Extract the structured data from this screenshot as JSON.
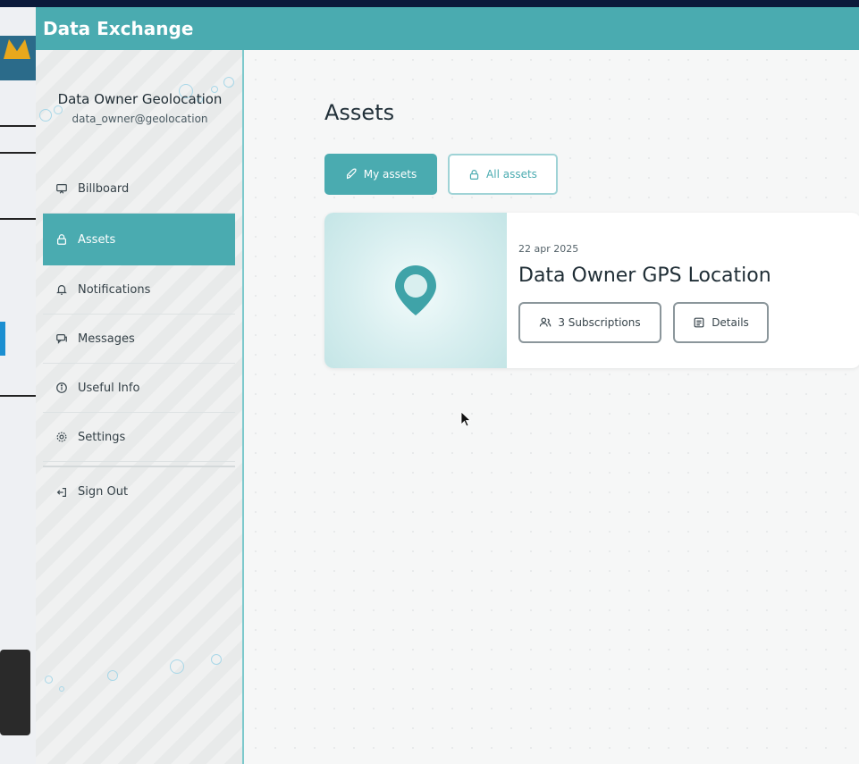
{
  "app": {
    "title": "Data Exchange"
  },
  "profile": {
    "name": "Data Owner Geolocation",
    "email": "data_owner@geolocation"
  },
  "sidebar": {
    "items": [
      {
        "label": "Billboard",
        "icon": "billboard-icon",
        "active": false
      },
      {
        "label": "Assets",
        "icon": "lock-icon",
        "active": true
      },
      {
        "label": "Notifications",
        "icon": "bell-icon",
        "active": false
      },
      {
        "label": "Messages",
        "icon": "messages-icon",
        "active": false
      },
      {
        "label": "Useful Info",
        "icon": "info-icon",
        "active": false
      },
      {
        "label": "Settings",
        "icon": "gear-icon",
        "active": false
      }
    ],
    "signout": {
      "label": "Sign Out",
      "icon": "sign-out-icon"
    }
  },
  "main": {
    "title": "Assets",
    "tabs": [
      {
        "label": "My assets",
        "icon": "rocket-icon",
        "selected": true
      },
      {
        "label": "All assets",
        "icon": "lock-icon",
        "selected": false
      }
    ],
    "asset": {
      "date": "22 apr 2025",
      "title": "Data Owner GPS Location",
      "thumb_icon": "location-pin-icon",
      "subscriptions_label": "3 Subscriptions",
      "details_label": "Details"
    }
  },
  "colors": {
    "accent": "#4aabb0",
    "accent_light": "#9fd3d6",
    "background": "#f6f7f7",
    "text": "#22313a"
  }
}
